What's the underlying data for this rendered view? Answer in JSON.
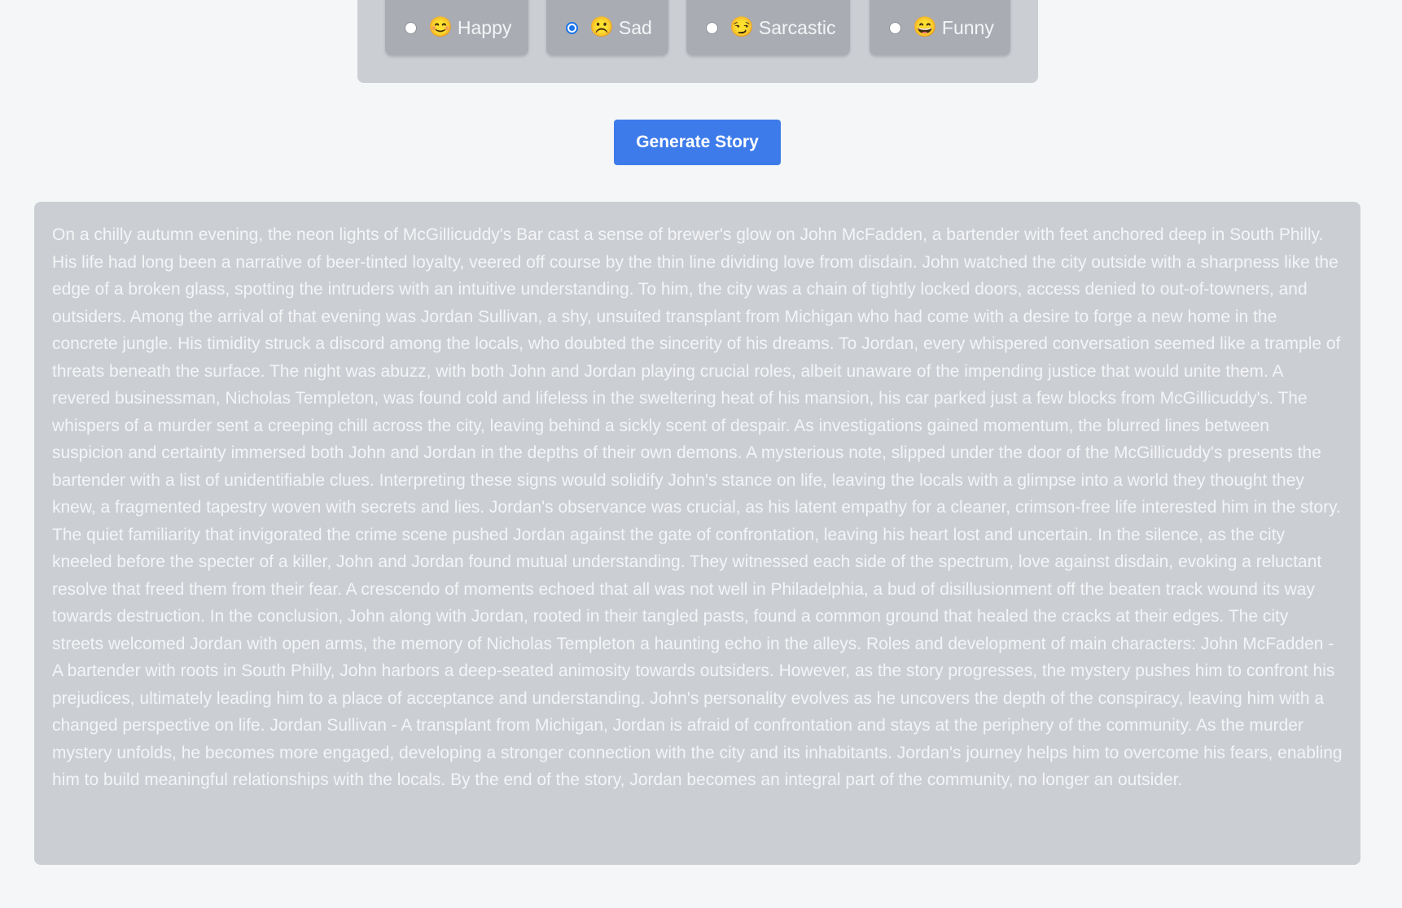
{
  "moods": [
    {
      "id": "happy",
      "emoji": "😊",
      "label": "Happy",
      "selected": false
    },
    {
      "id": "sad",
      "emoji": "☹️",
      "label": "Sad",
      "selected": true
    },
    {
      "id": "sarcastic",
      "emoji": "😏",
      "label": "Sarcastic",
      "selected": false
    },
    {
      "id": "funny",
      "emoji": "😄",
      "label": "Funny",
      "selected": false
    }
  ],
  "generate_button_label": "Generate Story",
  "story_text": "On a chilly autumn evening, the neon lights of McGillicuddy's Bar cast a sense of brewer's glow on John McFadden, a bartender with feet anchored deep in South Philly. His life had long been a narrative of beer-tinted loyalty, veered off course by the thin line dividing love from disdain. John watched the city outside with a sharpness like the edge of a broken glass, spotting the intruders with an intuitive understanding. To him, the city was a chain of tightly locked doors, access denied to out-of-towners, and outsiders. Among the arrival of that evening was Jordan Sullivan, a shy, unsuited transplant from Michigan who had come with a desire to forge a new home in the concrete jungle. His timidity struck a discord among the locals, who doubted the sincerity of his dreams. To Jordan, every whispered conversation seemed like a trample of threats beneath the surface. The night was abuzz, with both John and Jordan playing crucial roles, albeit unaware of the impending justice that would unite them. A revered businessman, Nicholas Templeton, was found cold and lifeless in the sweltering heat of his mansion, his car parked just a few blocks from McGillicuddy's. The whispers of a murder sent a creeping chill across the city, leaving behind a sickly scent of despair. As investigations gained momentum, the blurred lines between suspicion and certainty immersed both John and Jordan in the depths of their own demons. A mysterious note, slipped under the door of the McGillicuddy's presents the bartender with a list of unidentifiable clues. Interpreting these signs would solidify John's stance on life, leaving the locals with a glimpse into a world they thought they knew, a fragmented tapestry woven with secrets and lies. Jordan's observance was crucial, as his latent empathy for a cleaner, crimson-free life interested him in the story. The quiet familiarity that invigorated the crime scene pushed Jordan against the gate of confrontation, leaving his heart lost and uncertain. In the silence, as the city kneeled before the specter of a killer, John and Jordan found mutual understanding. They witnessed each side of the spectrum, love against disdain, evoking a reluctant resolve that freed them from their fear. A crescendo of moments echoed that all was not well in Philadelphia, a bud of disillusionment off the beaten track wound its way towards destruction. In the conclusion, John along with Jordan, rooted in their tangled pasts, found a common ground that healed the cracks at their edges. The city streets welcomed Jordan with open arms, the memory of Nicholas Templeton a haunting echo in the alleys. Roles and development of main characters: John McFadden - A bartender with roots in South Philly, John harbors a deep-seated animosity towards outsiders. However, as the story progresses, the mystery pushes him to confront his prejudices, ultimately leading him to a place of acceptance and understanding. John's personality evolves as he uncovers the depth of the conspiracy, leaving him with a changed perspective on life. Jordan Sullivan - A transplant from Michigan, Jordan is afraid of confrontation and stays at the periphery of the community. As the murder mystery unfolds, he becomes more engaged, developing a stronger connection with the city and its inhabitants. Jordan's journey helps him to overcome his fears, enabling him to build meaningful relationships with the locals. By the end of the story, Jordan becomes an integral part of the community, no longer an outsider.",
  "colors": {
    "accent": "#3d7bea",
    "radio_checked": "#1a73e8",
    "panel": "#cbced3",
    "option": "#a9adb3",
    "text": "#f4f5f7"
  }
}
